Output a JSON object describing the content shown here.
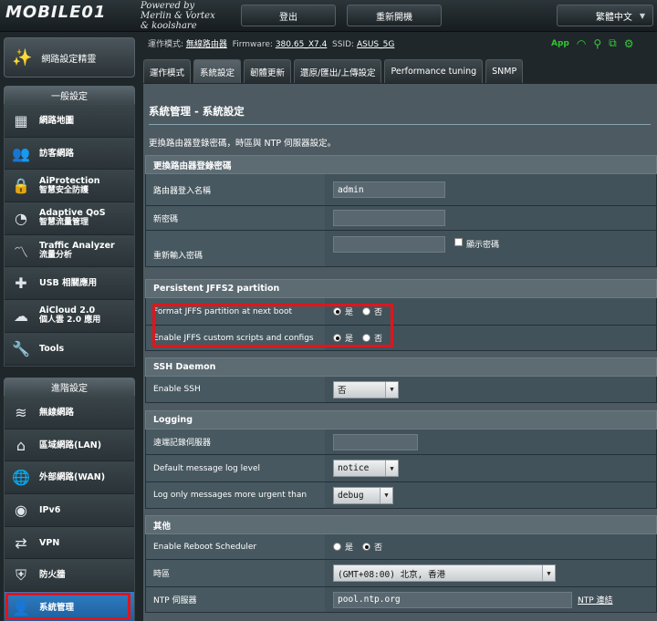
{
  "header": {
    "logo": "MOBILE01",
    "powered": [
      "Powered by",
      "Merlin & Vortex",
      "& koolshare"
    ],
    "logout_label": "登出",
    "reboot_label": "重新開機",
    "language": "繁體中文"
  },
  "wizard_label": "網路設定精靈",
  "general_section": {
    "title": "一般設定",
    "items": [
      {
        "icon": "network-map-icon",
        "label": "網路地圖",
        "sub": ""
      },
      {
        "icon": "guest-network-icon",
        "label": "訪客網路",
        "sub": ""
      },
      {
        "icon": "aiprotection-icon",
        "label": "AiProtection",
        "sub": "智慧安全防護"
      },
      {
        "icon": "adaptive-qos-icon",
        "label": "Adaptive QoS",
        "sub": "智慧流量管理"
      },
      {
        "icon": "traffic-analyzer-icon",
        "label": "Traffic Analyzer",
        "sub": "流量分析"
      },
      {
        "icon": "usb-icon",
        "label": "USB 相關應用",
        "sub": ""
      },
      {
        "icon": "aicloud-icon",
        "label": "AiCloud 2.0",
        "sub": "個人雲 2.0 應用"
      },
      {
        "icon": "tools-icon",
        "label": "Tools",
        "sub": ""
      }
    ]
  },
  "advanced_section": {
    "title": "進階設定",
    "items": [
      {
        "icon": "wireless-icon",
        "label": "無線網路"
      },
      {
        "icon": "lan-icon",
        "label": "區域網路(LAN)"
      },
      {
        "icon": "wan-icon",
        "label": "外部網路(WAN)"
      },
      {
        "icon": "ipv6-icon",
        "label": "IPv6"
      },
      {
        "icon": "vpn-icon",
        "label": "VPN"
      },
      {
        "icon": "firewall-icon",
        "label": "防火牆"
      },
      {
        "icon": "administration-icon",
        "label": "系統管理"
      }
    ]
  },
  "status": {
    "mode_label": "運作模式:",
    "mode_value": "無線路由器",
    "fw_label": "Firmware:",
    "fw_value": "380.65_X7.4",
    "ssid_label": "SSID:",
    "ssid_value": "ASUS_5G",
    "app_label": "App"
  },
  "tabs": [
    "運作模式",
    "系統設定",
    "韌體更新",
    "還原/匯出/上傳設定",
    "Performance tuning",
    "SNMP"
  ],
  "page": {
    "title": "系統管理 - 系統設定",
    "description": "更換路由器登錄密碼，時區與 NTP 伺服器設定。"
  },
  "password_section": {
    "header": "更換路由器登錄密碼",
    "username_label": "路由器登入名稱",
    "username_value": "admin",
    "new_password_label": "新密碼",
    "confirm_password_label": "重新輸入密碼",
    "show_password_label": "顯示密碼"
  },
  "jffs_section": {
    "header": "Persistent JFFS2 partition",
    "format_label": "Format JFFS partition at next boot",
    "scripts_label": "Enable JFFS custom scripts and configs",
    "yes_label": "是",
    "no_label": "否"
  },
  "ssh_section": {
    "header": "SSH Daemon",
    "enable_label": "Enable SSH",
    "enable_value": "否"
  },
  "logging_section": {
    "header": "Logging",
    "remote_label": "遠端記錄伺服器",
    "remote_value": "",
    "default_level_label": "Default message log level",
    "default_level_value": "notice",
    "urgent_label": "Log only messages more urgent than",
    "urgent_value": "debug"
  },
  "misc_section": {
    "header": "其他",
    "reboot_scheduler_label": "Enable Reboot Scheduler",
    "timezone_label": "時區",
    "timezone_value": "(GMT+08:00) 北京, 香港",
    "ntp_label": "NTP 伺服器",
    "ntp_value": "pool.ntp.org",
    "ntp_link": "NTP 連結",
    "yes_label": "是",
    "no_label": "否"
  },
  "colors": {
    "active_menu": "#2f7dc4",
    "highlight": "#e0151c",
    "app_green": "#30c631"
  }
}
